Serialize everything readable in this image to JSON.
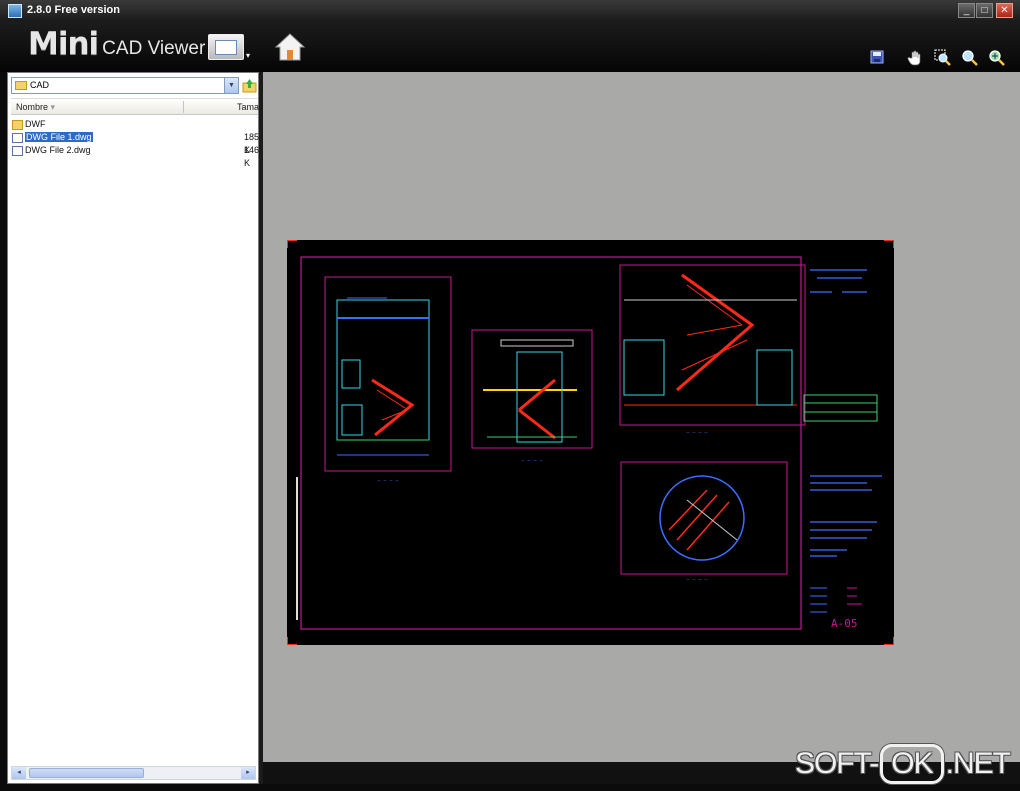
{
  "window": {
    "title": "2.8.0 Free version",
    "minimize": "_",
    "maximize": "□",
    "close": "✕"
  },
  "header": {
    "logo_big": "Mini",
    "logo_small": "CAD Viewer",
    "view_menu_arrow": "▾",
    "tools": [
      {
        "name": "save-icon",
        "glyph": "💾"
      },
      {
        "name": "pan-hand-icon",
        "glyph": "✋"
      },
      {
        "name": "zoom-window-icon",
        "glyph": "⊕"
      },
      {
        "name": "zoom-in-icon",
        "glyph": "🔍"
      },
      {
        "name": "zoom-extents-icon",
        "glyph": "⤢"
      }
    ]
  },
  "browser": {
    "folder": "CAD",
    "columns": {
      "name": "Nombre",
      "size": "Tamañ"
    },
    "items": [
      {
        "name": "DWF",
        "type": "folder",
        "size": "",
        "selected": false
      },
      {
        "name": "DWG File 1.dwg",
        "type": "file",
        "size": "185 K",
        "selected": true
      },
      {
        "name": "DWG File 2.dwg",
        "type": "file",
        "size": "146 K",
        "selected": false
      }
    ],
    "scroll_left": "◂",
    "scroll_right": "▸"
  },
  "drawing": {
    "sheet_number": "A-05"
  },
  "watermark": {
    "left": "SOFT-",
    "box": "OK",
    "right": ".NET"
  },
  "colors": {
    "canvas_bg": "#a9a9a7",
    "border_magenta": "#c3188f",
    "stair_red": "#ff2a1a",
    "line_cyan": "#35d6e8",
    "line_blue": "#3c6dff",
    "line_green": "#3bd16b",
    "selection_blue": "#316ac5"
  }
}
